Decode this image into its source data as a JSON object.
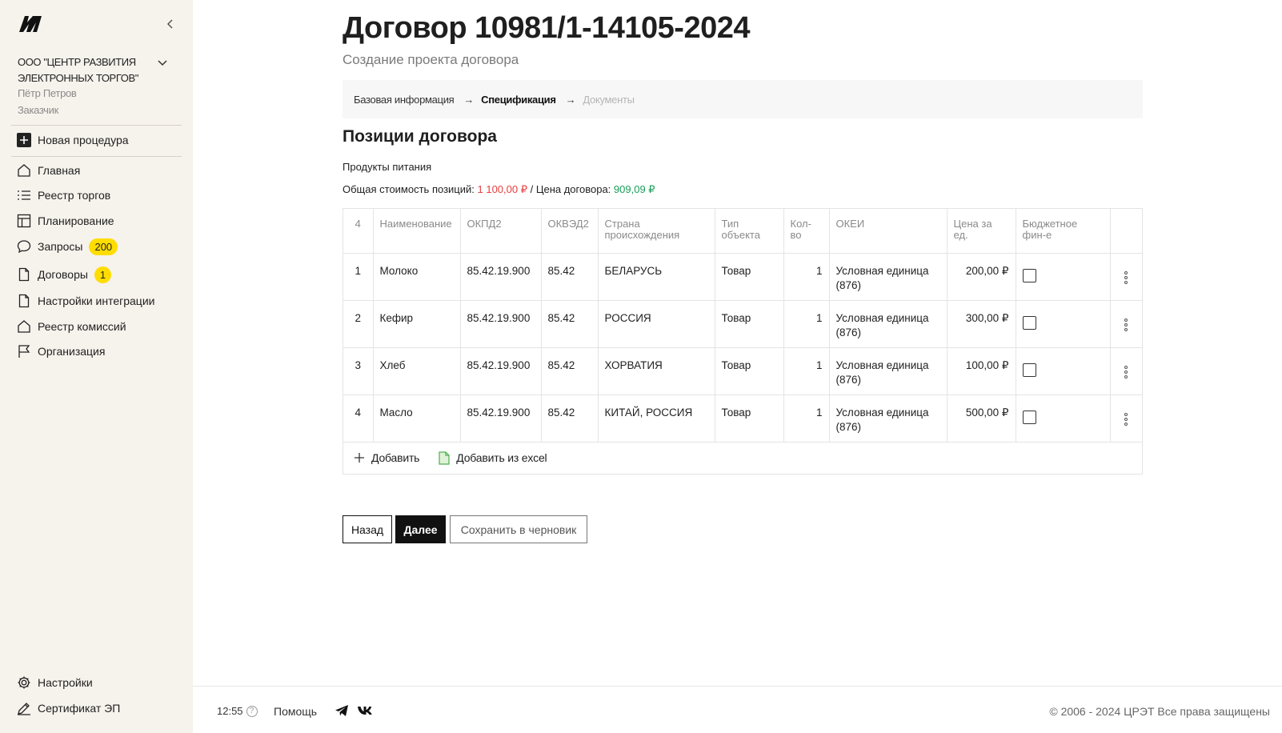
{
  "sidebar": {
    "org_name": "ООО \"ЦЕНТР РАЗВИТИЯ ЭЛЕКТРОННЫХ ТОРГОВ\"",
    "user_name": "Пётр Петров",
    "user_role": "Заказчик",
    "new_procedure": "Новая процедура",
    "items": [
      {
        "label": "Главная",
        "icon": "home-icon"
      },
      {
        "label": "Реестр торгов",
        "icon": "list-icon"
      },
      {
        "label": "Планирование",
        "icon": "table-icon"
      },
      {
        "label": "Запросы",
        "icon": "chat-icon",
        "badge": "200"
      },
      {
        "label": "Договоры",
        "icon": "document-icon",
        "badge": "1"
      },
      {
        "label": "Настройки интеграции",
        "icon": "document-icon"
      },
      {
        "label": "Реестр комиссий",
        "icon": "home-icon"
      },
      {
        "label": "Организация",
        "icon": "flag-icon"
      }
    ],
    "settings": "Настройки",
    "certificate": "Сертификат ЭП"
  },
  "page": {
    "title": "Договор 10981/1-14105-2024",
    "subtitle": "Создание проекта договора"
  },
  "steps": {
    "step1": "Базовая информация",
    "step2": "Спецификация",
    "step3": "Документы",
    "arrow": "→"
  },
  "section": {
    "title": "Позиции договора",
    "category": "Продукты питания",
    "totals_label": "Общая стоимость позиций:",
    "total_positions": "1 100,00 ₽",
    "contract_price_label": "/ Цена договора:",
    "contract_price": "909,09 ₽"
  },
  "table": {
    "headers": {
      "count": "4",
      "name": "Наименование",
      "okpd2": "ОКПД2",
      "okved2": "ОКВЭД2",
      "country": "Страна происхождения",
      "type": "Тип объекта",
      "qty": "Кол-во",
      "okei": "ОКЕИ",
      "price": "Цена за ед.",
      "budget": "Бюджетное фин-е"
    },
    "rows": [
      {
        "n": "1",
        "name": "Молоко",
        "okpd2": "85.42.19.900",
        "okved2": "85.42",
        "country": "БЕЛАРУСЬ",
        "type": "Товар",
        "qty": "1",
        "okei": "Условная единица (876)",
        "price": "200,00 ₽"
      },
      {
        "n": "2",
        "name": "Кефир",
        "okpd2": "85.42.19.900",
        "okved2": "85.42",
        "country": "РОССИЯ",
        "type": "Товар",
        "qty": "1",
        "okei": "Условная единица (876)",
        "price": "300,00 ₽"
      },
      {
        "n": "3",
        "name": "Хлеб",
        "okpd2": "85.42.19.900",
        "okved2": "85.42",
        "country": "ХОРВАТИЯ",
        "type": "Товар",
        "qty": "1",
        "okei": "Условная единица (876)",
        "price": "100,00 ₽"
      },
      {
        "n": "4",
        "name": "Масло",
        "okpd2": "85.42.19.900",
        "okved2": "85.42",
        "country": "КИТАЙ, РОССИЯ",
        "type": "Товар",
        "qty": "1",
        "okei": "Условная единица (876)",
        "price": "500,00 ₽"
      }
    ],
    "add": "Добавить",
    "add_excel": "Добавить из excel"
  },
  "buttons": {
    "back": "Назад",
    "next": "Далее",
    "draft": "Сохранить в черновик"
  },
  "footer": {
    "time": "12:55",
    "help_icon": "?",
    "help": "Помощь",
    "copyright": "© 2006 - 2024 ЦРЭТ Все права защищены"
  },
  "colors": {
    "sidebar_bg": "#f6f2ec",
    "badge": "#ffdd00",
    "total_red": "#e84040",
    "price_green": "#19a05a",
    "excel_green": "#4caf50"
  }
}
